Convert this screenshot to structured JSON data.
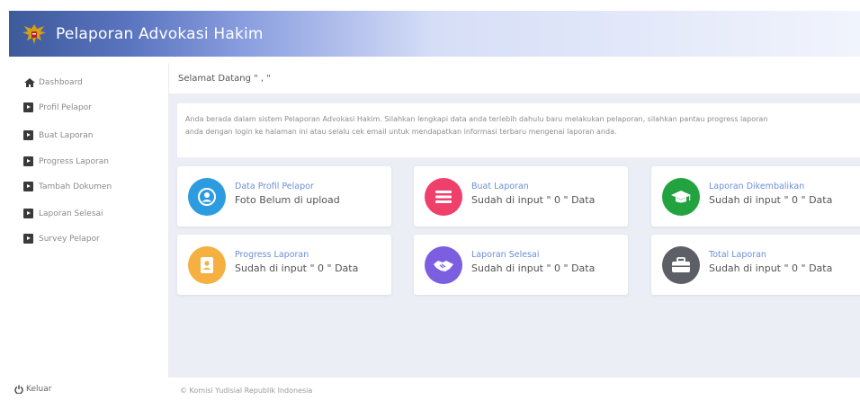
{
  "header": {
    "title": "Pelaporan Advokasi Hakim",
    "emblem_icon": "garuda-emblem-icon"
  },
  "sidebar": {
    "items": [
      {
        "label": "Dashboard",
        "icon": "home-icon"
      },
      {
        "label": "Profil Pelapor",
        "icon": "arrow-square-icon"
      },
      {
        "label": "Buat Laporan",
        "icon": "arrow-square-icon"
      },
      {
        "label": "Progress Laporan",
        "icon": "arrow-square-icon"
      },
      {
        "label": "Tambah Dokumen",
        "icon": "arrow-square-icon"
      },
      {
        "label": "Laporan Selesai",
        "icon": "arrow-square-icon"
      },
      {
        "label": "Survey Pelapor",
        "icon": "arrow-square-icon"
      }
    ],
    "logout_label": "Keluar"
  },
  "main": {
    "welcome": "Selamat Datang \" , \"",
    "info_line1": "Anda berada dalam sistem Pelaporan Advokasi Hakim. Silahkan lengkapi data anda terlebih dahulu baru melakukan pelaporan, silahkan pantau progress laporan",
    "info_line2": "anda dengan login ke halaman ini atau selalu cek email untuk mendapatkan informasi terbaru mengenai laporan anda.",
    "cards": [
      {
        "title": "Data Profil Pelapor",
        "value": "Foto Belum di upload",
        "color": "#2d9be0",
        "icon": "user-icon"
      },
      {
        "title": "Buat Laporan",
        "value": "Sudah di input \" 0 \" Data",
        "color": "#ef3f6b",
        "icon": "list-icon"
      },
      {
        "title": "Laporan Dikembalikan",
        "value": "Sudah di input \" 0 \" Data",
        "color": "#23a340",
        "icon": "graduation-cap-icon"
      },
      {
        "title": "Progress Laporan",
        "value": "Sudah di input \" 0 \" Data",
        "color": "#f5b041",
        "icon": "id-badge-icon"
      },
      {
        "title": "Laporan Selesai",
        "value": "Sudah di input \" 0 \" Data",
        "color": "#7b5fe0",
        "icon": "handshake-icon"
      },
      {
        "title": "Total Laporan",
        "value": "Sudah di input \" 0 \" Data",
        "color": "#5c5f66",
        "icon": "briefcase-icon"
      }
    ]
  },
  "footer": {
    "copyright": "© Komisi Yudisial Republik Indonesia"
  }
}
